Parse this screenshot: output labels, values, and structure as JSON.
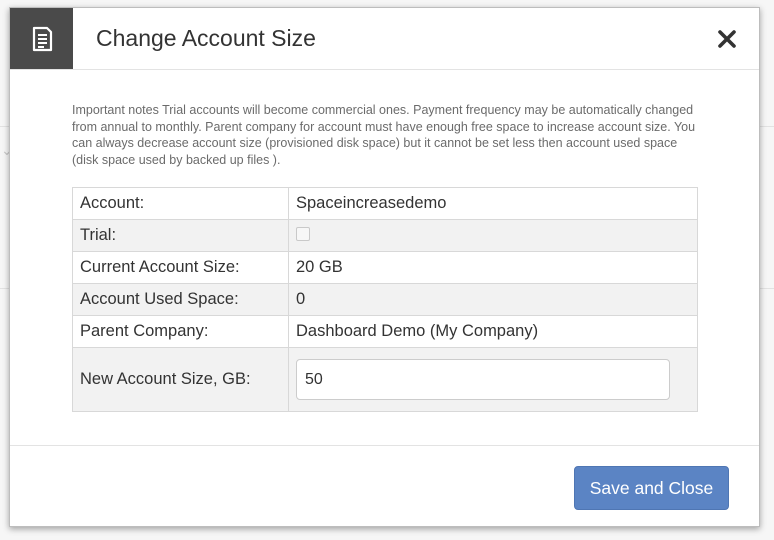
{
  "dialog": {
    "title": "Change Account Size",
    "icon": "document-icon",
    "close_icon": "close-icon",
    "notes": "Important notes Trial accounts will become commercial ones. Payment frequency may be automatically changed from annual to monthly. Parent company for account must have enough free space to increase account size. You can always decrease account size (provisioned disk space) but it cannot be set less then account used space (disk space used by backed up files ).",
    "fields": {
      "account": {
        "label": "Account:",
        "value": "Spaceincreasedemo"
      },
      "trial": {
        "label": "Trial:",
        "checked": false
      },
      "current_size": {
        "label": "Current Account Size:",
        "value": "20 GB"
      },
      "used_space": {
        "label": "Account Used Space:",
        "value": "0"
      },
      "parent_company": {
        "label": "Parent Company:",
        "value": "Dashboard Demo (My Company)"
      },
      "new_size": {
        "label": "New Account Size, GB:",
        "value": "50"
      }
    },
    "save_label": "Save and Close"
  },
  "colors": {
    "header_icon_bg": "#4a4a4a",
    "primary_button": "#5b84c4",
    "title_text": "#333333",
    "notes_text": "#6b6b6b"
  }
}
